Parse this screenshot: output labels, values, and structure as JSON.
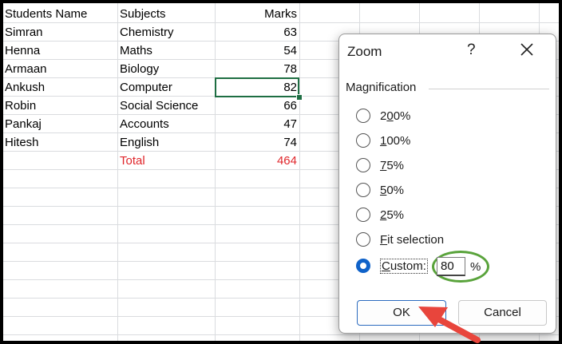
{
  "sheet": {
    "headers": {
      "name": "Students Name",
      "subject": "Subjects",
      "marks": "Marks"
    },
    "rows": [
      {
        "name": "Simran",
        "subject": "Chemistry",
        "marks": "63"
      },
      {
        "name": "Henna",
        "subject": "Maths",
        "marks": "54"
      },
      {
        "name": "Armaan",
        "subject": "Biology",
        "marks": "78"
      },
      {
        "name": "Ankush",
        "subject": "Computer",
        "marks": "82"
      },
      {
        "name": "Robin",
        "subject": "Social Science",
        "marks": "66"
      },
      {
        "name": "Pankaj",
        "subject": "Accounts",
        "marks": "47"
      },
      {
        "name": "Hitesh",
        "subject": "English",
        "marks": "74"
      }
    ],
    "total": {
      "label": "Total",
      "value": "464"
    },
    "total_color": "#e0262b",
    "selection_color": "#1e6e43"
  },
  "dialog": {
    "title": "Zoom",
    "help": "?",
    "close_icon": "close-icon",
    "group_label": "Magnification",
    "options": [
      {
        "label": "200%",
        "accel": "0",
        "selected": false
      },
      {
        "label": "100%",
        "accel": "1",
        "selected": false
      },
      {
        "label": "75%",
        "accel": "7",
        "selected": false
      },
      {
        "label": "50%",
        "accel": "5",
        "selected": false
      },
      {
        "label": "25%",
        "accel": "2",
        "selected": false
      },
      {
        "label": "Fit selection",
        "accel": "F",
        "selected": false
      },
      {
        "label": "Custom:",
        "accel": "C",
        "selected": true
      }
    ],
    "custom_value": "80",
    "percent_sign": "%",
    "ok_label": "OK",
    "cancel_label": "Cancel",
    "accent_color": "#0f62c9",
    "highlight_color": "#59a33b",
    "arrow_color": "#e8453c"
  }
}
